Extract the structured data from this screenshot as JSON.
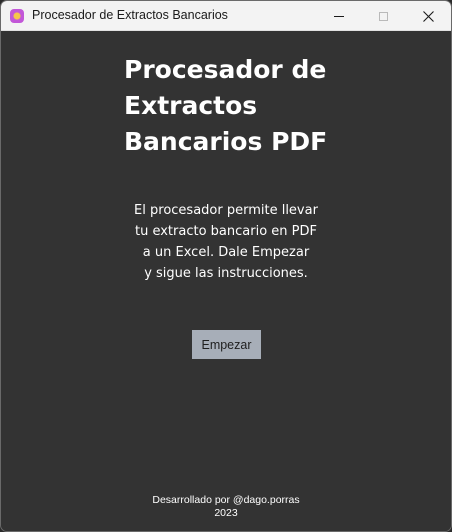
{
  "window": {
    "title": "Procesador de Extractos Bancarios",
    "controls": {
      "minimize_icon": "minimize-icon",
      "maximize_icon": "maximize-icon",
      "close_icon": "close-icon"
    }
  },
  "main": {
    "heading_lines": [
      "Procesador de",
      "Extractos",
      "Bancarios PDF"
    ],
    "description_lines": [
      "El procesador permite llevar",
      "tu extracto bancario en PDF",
      "a un Excel. Dale Empezar",
      "y sigue las instrucciones."
    ],
    "start_button_label": "Empezar"
  },
  "footer": {
    "credit": "Desarrollado por @dago.porras",
    "year": "2023"
  },
  "colors": {
    "background": "#333333",
    "titlebar": "#f3f3f3",
    "button": "#a7aeb8",
    "text": "#ffffff"
  }
}
